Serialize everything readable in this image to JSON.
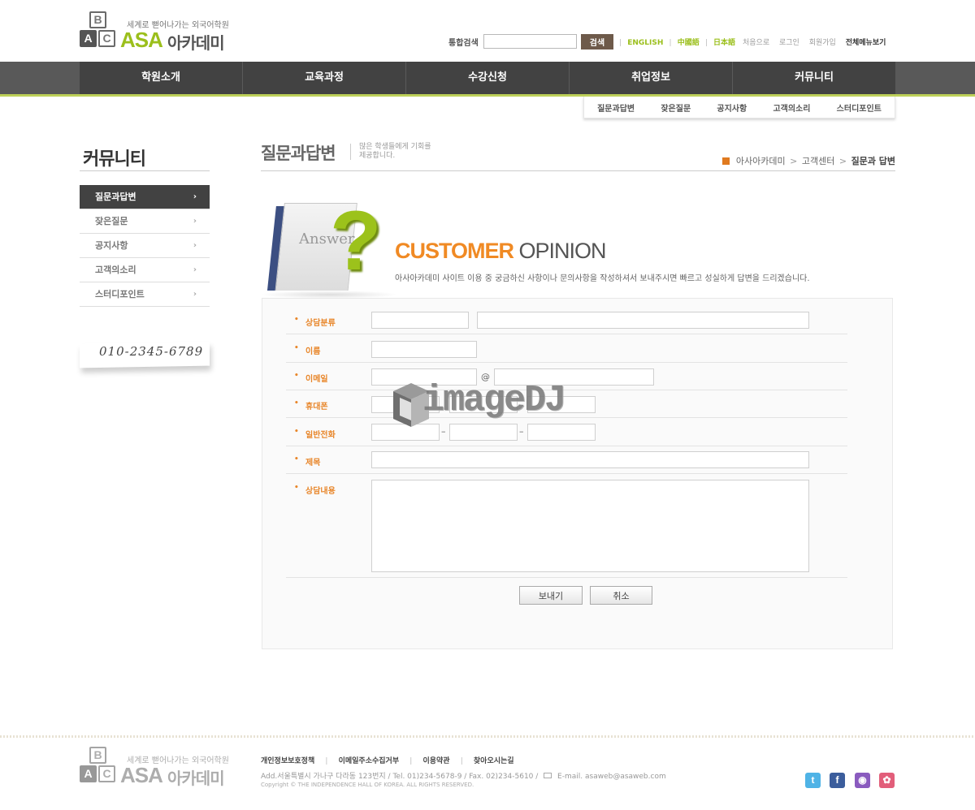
{
  "logo": {
    "slogan": "세계로 뻗어나가는 외국어학원",
    "block_b": "B",
    "block_a": "A",
    "block_c": "C",
    "brand": "ASA",
    "name": "아카데미"
  },
  "search": {
    "label": "통합검색",
    "value": "",
    "button": "검색"
  },
  "languages": [
    "ENGLISH",
    "中國語",
    "日本語"
  ],
  "util_links": [
    "처음으로",
    "로그인",
    "회원가입"
  ],
  "full_menu": "전체메뉴보기",
  "gnb": [
    "학원소개",
    "교육과정",
    "수강신청",
    "취업정보",
    "커뮤니티"
  ],
  "subnav": [
    "질문과답변",
    "잦은질문",
    "공지사항",
    "고객의소리",
    "스터디포인트"
  ],
  "lnb": {
    "title": "커뮤니티",
    "items": [
      {
        "label": "질문과답변",
        "active": true
      },
      {
        "label": "잦은질문",
        "active": false
      },
      {
        "label": "공지사항",
        "active": false
      },
      {
        "label": "고객의소리",
        "active": false
      },
      {
        "label": "스터디포인트",
        "active": false
      }
    ],
    "arrow": "›",
    "phone": "010-2345-6789"
  },
  "page": {
    "title": "질문과답변",
    "desc_line1": "많은 학생들에게 기회를",
    "desc_line2": "제공합니다.",
    "breadcrumb": [
      "아사아카데미",
      "고객센터",
      "질문과 답변"
    ],
    "breadcrumb_sep": ">"
  },
  "visual": {
    "answer_text": "Answer",
    "qmark": "?",
    "title_customer": "CUSTOMER",
    "title_opinion": "OPINION",
    "desc": "아사아카데미 사이트 이용 중 궁금하신 사항이나 문의사항을 작성하셔서 보내주시면 빠르고 성실하게 답변을 드리겠습니다."
  },
  "form": {
    "fields": {
      "category": "상담분류",
      "name": "이름",
      "email": "이메일",
      "mobile": "휴대폰",
      "phone": "일반전화",
      "subject": "제목",
      "content": "상담내용"
    },
    "at": "@",
    "dash": "–",
    "values": {
      "category1": "",
      "category2": "",
      "name": "",
      "email_id": "",
      "email_domain": "",
      "mobile1": "",
      "mobile2": "",
      "mobile3": "",
      "phone1": "",
      "phone2": "",
      "phone3": "",
      "subject": "",
      "content": ""
    },
    "submit": "보내기",
    "cancel": "취소"
  },
  "watermark": "imageDJ",
  "footer": {
    "links": [
      "개인정보보호정책",
      "이메일주소수집거부",
      "이용약관",
      "찾아오시는길"
    ],
    "link_sep": "|",
    "address": "Add.서울특별시 가나구 다라동 123번지  /  Tel. 01)234-5678-9  /  Fax. 02)234-5610  /",
    "email": "E-mail. asaweb@asaweb.com",
    "copyright": "Copyright © THE INDEPENDENCE HALL OF KOREA. ALL RIGHTS RESERVED."
  },
  "sns": [
    {
      "icon": "twitter-icon",
      "glyph": "t"
    },
    {
      "icon": "facebook-icon",
      "glyph": "f"
    },
    {
      "icon": "podcast-icon",
      "glyph": "◉"
    },
    {
      "icon": "blog-icon",
      "glyph": "✿"
    }
  ],
  "colors": {
    "accent_green": "#9bbf1c",
    "accent_orange": "#f08a24",
    "gnb_dark": "#424242",
    "label_orange": "#e8862a"
  }
}
